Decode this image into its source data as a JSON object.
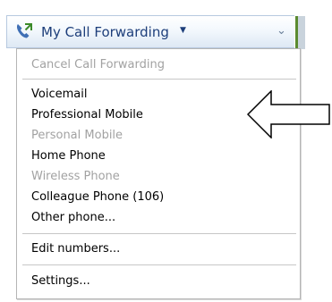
{
  "header": {
    "title": "My Call Forwarding",
    "caret_icon": "caret-down-icon",
    "collapse_icon": "double-chevron-down-icon",
    "call_icon": "phone-forward-icon",
    "accent_color": "#5a8a30",
    "title_color": "#1d3e7a"
  },
  "menu": {
    "cancel_label": "Cancel Call Forwarding",
    "voicemail_label": "Voicemail",
    "professional_mobile_label": "Professional Mobile",
    "personal_mobile_label": "Personal Mobile",
    "home_phone_label": "Home Phone",
    "wireless_phone_label": "Wireless Phone",
    "colleague_phone_label": "Colleague Phone (106)",
    "other_phone_label": "Other phone...",
    "edit_numbers_label": "Edit numbers...",
    "settings_label": "Settings...",
    "disabled_color": "#a2a2a2"
  },
  "annotation": {
    "arrow_icon": "pointing-left-arrow-icon"
  }
}
